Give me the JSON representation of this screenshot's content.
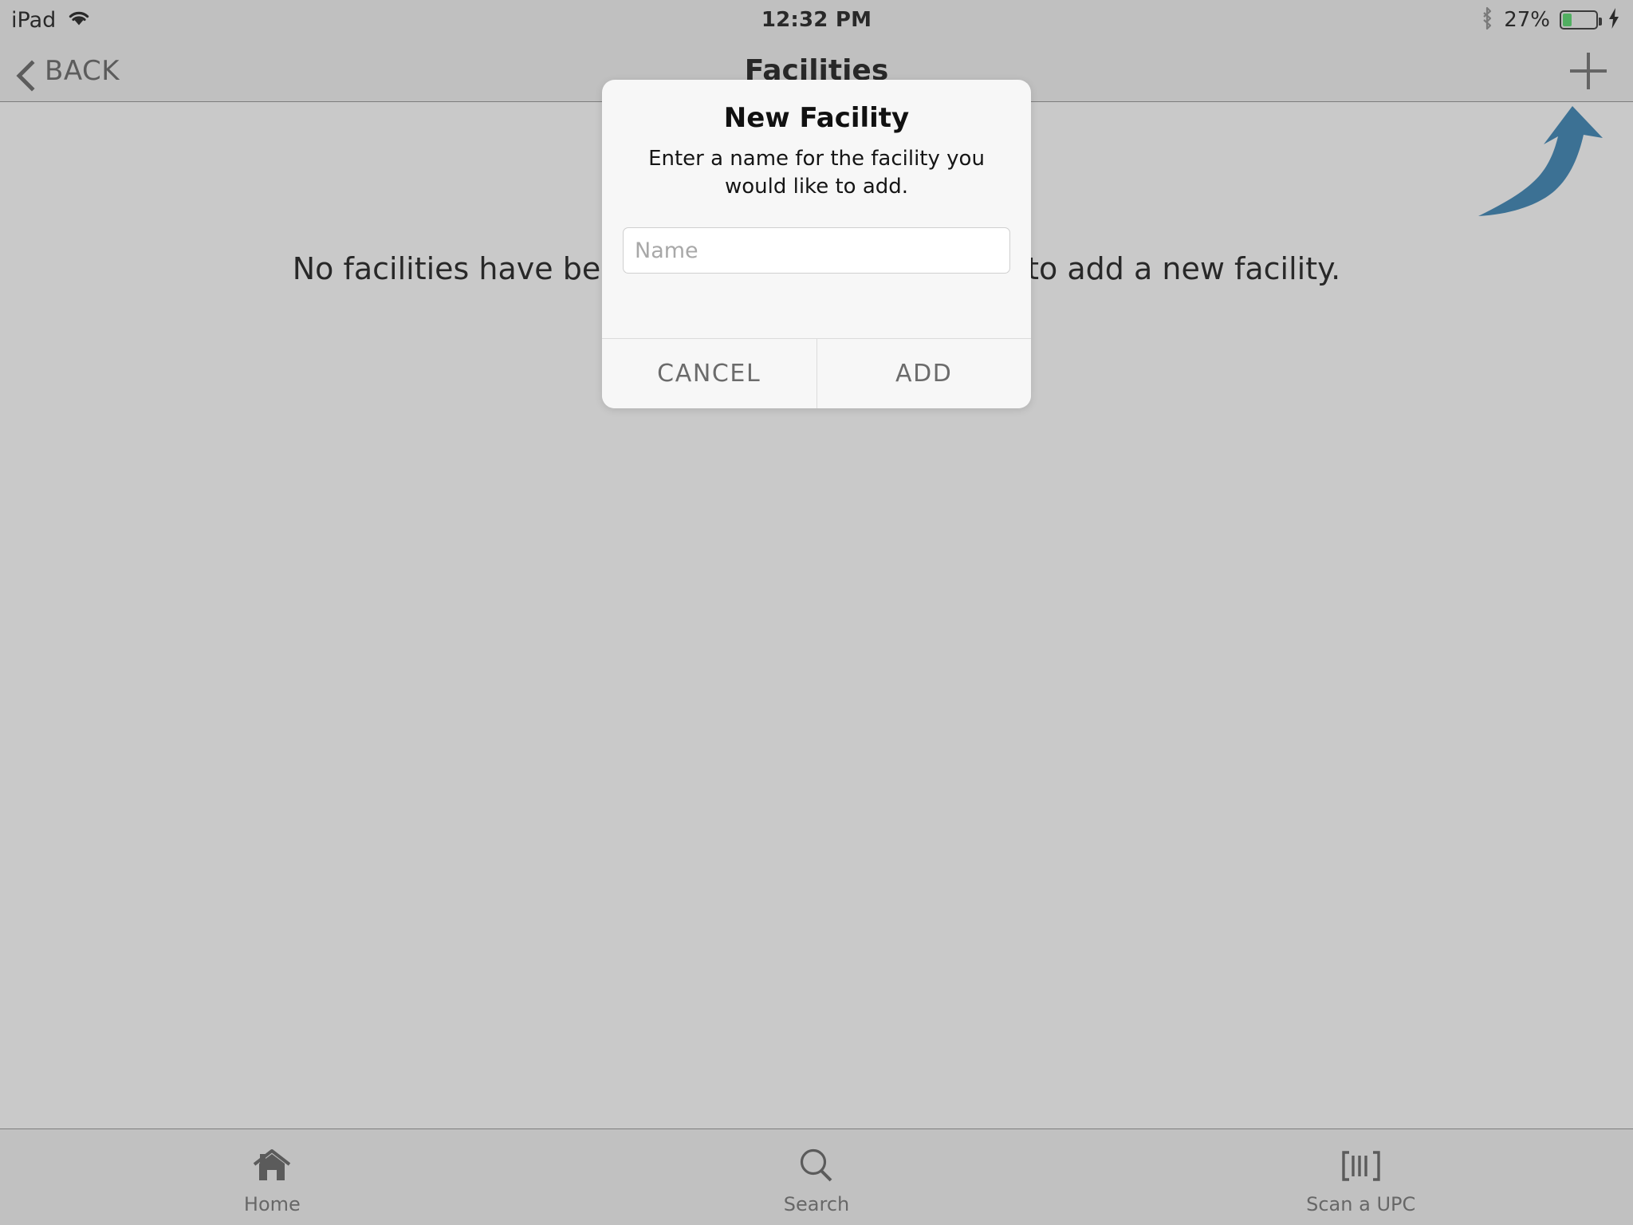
{
  "status_bar": {
    "device_name": "iPad",
    "wifi_icon": "wifi-icon",
    "time": "12:32 PM",
    "bluetooth_icon": "bluetooth-icon",
    "battery_percent_label": "27%",
    "battery_level": 27,
    "battery_color": "#4cd964",
    "charging_icon": "lightning-bolt-icon"
  },
  "nav_bar": {
    "back_label": "BACK",
    "back_icon": "chevron-left-icon",
    "title": "Facilities",
    "add_icon": "plus-icon"
  },
  "content": {
    "empty_message": "No facilities have been added. Tap the + button to add a new facility.",
    "arrow_hint_icon": "curved-arrow-up-right-icon",
    "arrow_color": "#2e7cb0"
  },
  "dialog": {
    "title": "New Facility",
    "message": "Enter a name for the facility you would like to add.",
    "input_placeholder": "Name",
    "input_value": "",
    "cancel_label": "CANCEL",
    "add_label": "ADD"
  },
  "tab_bar": {
    "tabs": [
      {
        "label": "Home",
        "icon": "home-icon"
      },
      {
        "label": "Search",
        "icon": "search-icon"
      },
      {
        "label": "Scan a UPC",
        "icon": "barcode-icon"
      }
    ]
  }
}
